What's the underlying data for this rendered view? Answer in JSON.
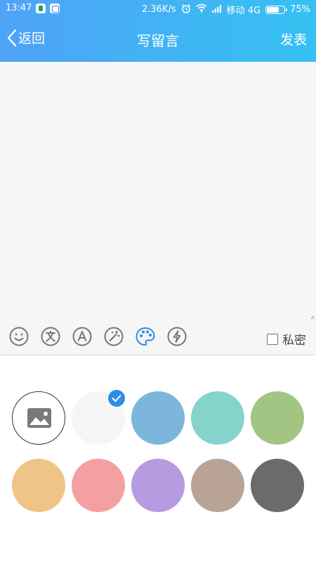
{
  "status_bar": {
    "time": "13:47",
    "speed": "2.36K/s",
    "carrier": "移动 4G",
    "battery": "75%",
    "battery_level": 0.75,
    "icons": [
      "app-notification-icon",
      "app-notification-icon-2",
      "alarm-clock-icon",
      "wifi-icon",
      "signal-icon",
      "battery-icon"
    ]
  },
  "nav": {
    "back_label": "返回",
    "title": "写留言",
    "publish_label": "发表"
  },
  "editor": {
    "value": "",
    "placeholder": ""
  },
  "toolbar": {
    "icons": [
      "emoji-icon",
      "text-style-icon",
      "font-icon",
      "magic-wand-icon",
      "palette-icon",
      "flash-icon"
    ],
    "active_icon": "palette-icon",
    "private_label": "私密",
    "private_checked": false
  },
  "palette": {
    "selected": "white",
    "colors": [
      {
        "name": "white",
        "hex": "#f5f5f5"
      },
      {
        "name": "blue",
        "hex": "#7cb6da"
      },
      {
        "name": "teal",
        "hex": "#85d4cb"
      },
      {
        "name": "green",
        "hex": "#a3c583"
      },
      {
        "name": "orange",
        "hex": "#f0c487"
      },
      {
        "name": "pink",
        "hex": "#f4a0a2"
      },
      {
        "name": "purple",
        "hex": "#b79be0"
      },
      {
        "name": "taupe",
        "hex": "#b8a395"
      },
      {
        "name": "dark-gray",
        "hex": "#6b6b6b"
      }
    ],
    "accent": "#2b8de8"
  }
}
